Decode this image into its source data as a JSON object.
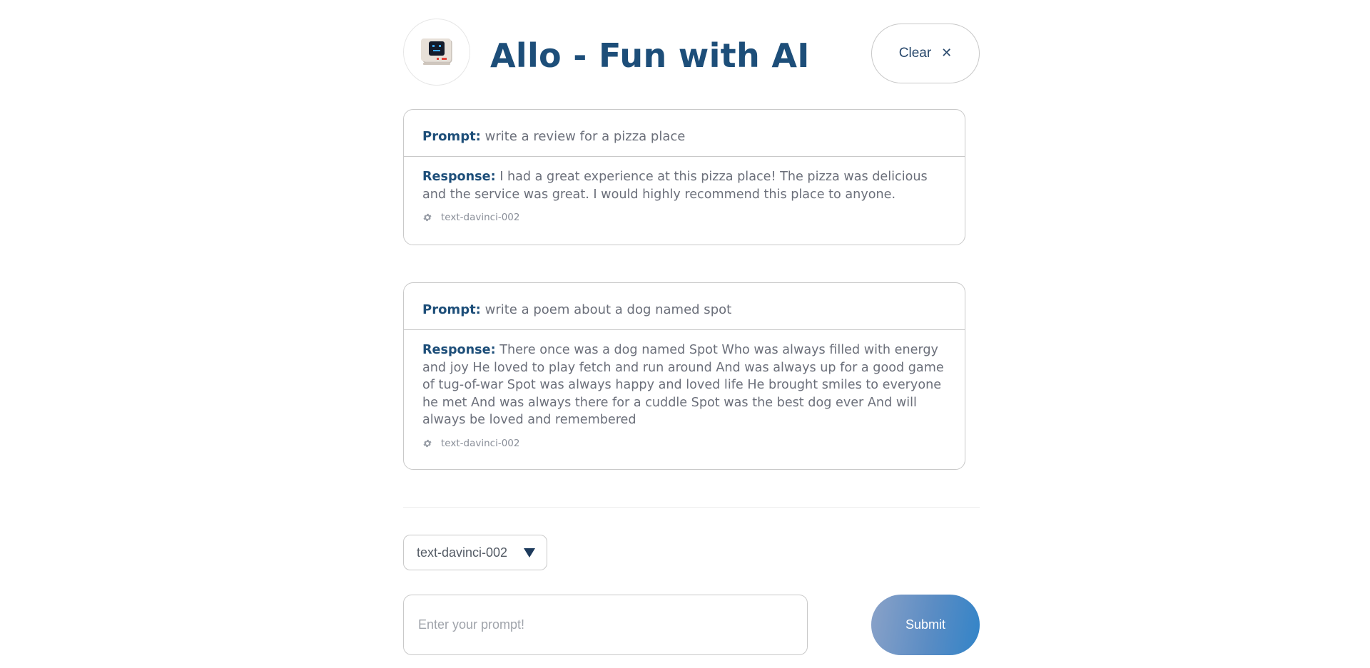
{
  "header": {
    "title": "Allo - Fun with AI",
    "avatar_icon": "robot-computer-icon",
    "clear_label": "Clear",
    "clear_icon": "close-icon"
  },
  "conversation": [
    {
      "prompt_label": "Prompt:",
      "prompt": "write a review for a pizza place",
      "response_label": "Response:",
      "response": "I had a great experience at this pizza place! The pizza was delicious and the service was great. I would highly recommend this place to anyone.",
      "model_icon": "gear-icon",
      "model": "text-davinci-002"
    },
    {
      "prompt_label": "Prompt:",
      "prompt": "write a poem about a dog named spot",
      "response_label": "Response:",
      "response": "There once was a dog named Spot Who was always filled with energy and joy He loved to play fetch and run around And was always up for a good game of tug-of-war Spot was always happy and loved life He brought smiles to everyone he met And was always there for a cuddle Spot was the best dog ever And will always be loved and remembered",
      "model_icon": "gear-icon",
      "model": "text-davinci-002"
    }
  ],
  "composer": {
    "model_select": {
      "selected": "text-davinci-002",
      "arrow_icon": "chevron-down-icon"
    },
    "input": {
      "value": "",
      "placeholder": "Enter your prompt!"
    },
    "submit_label": "Submit"
  },
  "colors": {
    "title": "#1d4e79",
    "label": "#1d4e79",
    "text": "#6b6f7a",
    "border": "#c9c9c9",
    "submit_gradient_start": "#8aa2c8",
    "submit_gradient_end": "#3284c8"
  }
}
